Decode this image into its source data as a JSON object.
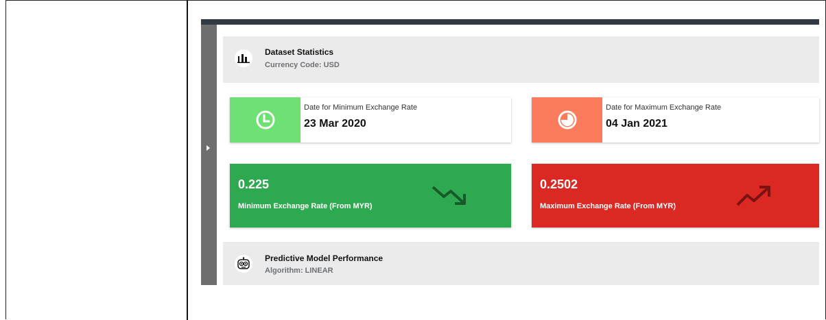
{
  "dataset_section": {
    "title": "Dataset Statistics",
    "subtitle": "Currency Code: USD",
    "icon": "bar-chart-icon"
  },
  "min_date_box": {
    "label": "Date for Minimum Exchange Rate",
    "value": "23 Mar 2020",
    "icon": "clock-icon",
    "color": "#6fe074"
  },
  "max_date_box": {
    "label": "Date for Maximum Exchange Rate",
    "value": "04 Jan 2021",
    "icon": "pie-clock-icon",
    "color": "#fb7b5d"
  },
  "min_rate_box": {
    "value": "0.225",
    "label": "Minimum Exchange Rate (From MYR)",
    "icon": "trend-down-icon",
    "color": "#2ea94f"
  },
  "max_rate_box": {
    "value": "0.2502",
    "label": "Maximum Exchange Rate (From MYR)",
    "icon": "trend-up-icon",
    "color": "#db2823"
  },
  "model_section": {
    "title": "Predictive Model Performance",
    "subtitle": "Algorithm: LINEAR",
    "icon": "robot-icon"
  }
}
